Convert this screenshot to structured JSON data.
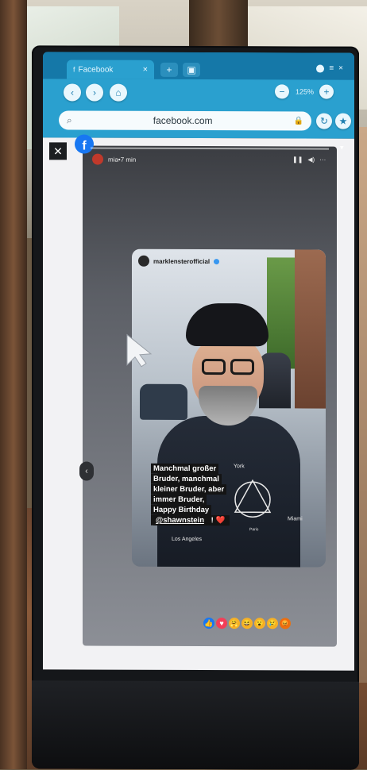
{
  "browser": {
    "tab_title": "Facebook",
    "tab_close": "×",
    "new_tab": "+",
    "zoom_level": "125%",
    "address": "facebook.com",
    "window_controls": [
      "≡",
      "×"
    ]
  },
  "story": {
    "author_name": "mia•7 min",
    "card_user": "marklensterofficial",
    "caption_lines": [
      "Manchmal großer",
      "Bruder, manchmal",
      "kleiner Bruder, aber",
      "immer Bruder,",
      "Happy Birthday"
    ],
    "caption_mention": "@shawnstein",
    "caption_suffix": " ! ❤️",
    "print_york": "York",
    "print_la": "Los Angeles",
    "print_miami": "Miami",
    "print_paris": "Paris"
  },
  "reactions": [
    {
      "name": "like",
      "color": "#1877f2",
      "glyph": "👍"
    },
    {
      "name": "love",
      "color": "#f33e58",
      "glyph": "♥"
    },
    {
      "name": "care",
      "color": "#f7b125",
      "glyph": "🤗"
    },
    {
      "name": "haha",
      "color": "#f7b125",
      "glyph": "😆"
    },
    {
      "name": "wow",
      "color": "#f7b125",
      "glyph": "😮"
    },
    {
      "name": "sad",
      "color": "#f7b125",
      "glyph": "😢"
    },
    {
      "name": "angry",
      "color": "#e9710f",
      "glyph": "😡"
    }
  ],
  "colors": {
    "chrome": "#2aa0cf",
    "fb_blue": "#1877f2"
  }
}
